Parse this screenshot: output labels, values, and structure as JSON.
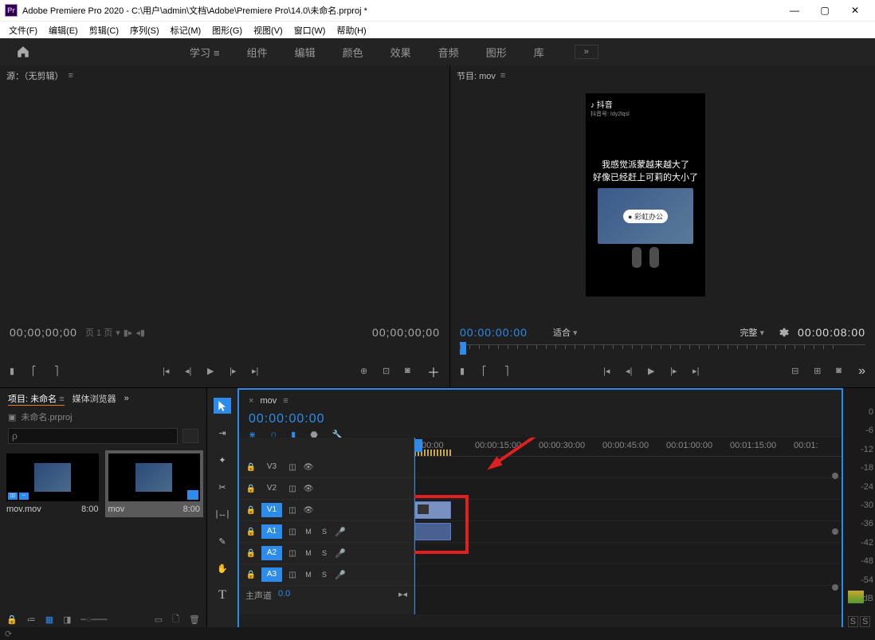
{
  "title": "Adobe Premiere Pro 2020 - C:\\用户\\admin\\文档\\Adobe\\Premiere Pro\\14.0\\未命名.prproj *",
  "menu": [
    "文件(F)",
    "编辑(E)",
    "剪辑(C)",
    "序列(S)",
    "标记(M)",
    "图形(G)",
    "视图(V)",
    "窗口(W)",
    "帮助(H)"
  ],
  "workspaces": {
    "items": [
      "学习",
      "组件",
      "编辑",
      "颜色",
      "效果",
      "音频",
      "图形",
      "库"
    ],
    "active": "学习",
    "more": "»"
  },
  "source": {
    "title": "源：（无剪辑）",
    "tc_left": "00;00;00;00",
    "tc_right": "00;00;00;00",
    "page": "页 1 页"
  },
  "program": {
    "title": "节目: mov",
    "tc_left": "00:00:00:00",
    "fit": "适合",
    "full": "完整",
    "tc_right": "00:00:08:00",
    "video": {
      "brand": "♪ 抖音",
      "brand_sub": "抖音号: Idy2lqsl",
      "caption1": "我感觉派蒙越来越大了",
      "caption2": "好像已经赶上可莉的大小了",
      "badge": "● 彩虹办公"
    }
  },
  "project": {
    "tabs": [
      "项目: 未命名",
      "媒体浏览器"
    ],
    "file": "未命名.prproj",
    "search_placeholder": "ρ",
    "items": [
      {
        "name": "mov.mov",
        "dur": "8:00"
      },
      {
        "name": "mov",
        "dur": "8:00"
      }
    ]
  },
  "timeline": {
    "seq": "mov",
    "tc": "00:00:00:00",
    "ruler": [
      ":00:00",
      "00:00:15:00",
      "00:00:30:00",
      "00:00:45:00",
      "00:01:00:00",
      "00:01:15:00",
      "00:01:"
    ],
    "tracks_v": [
      "V3",
      "V2",
      "V1"
    ],
    "tracks_a": [
      "A1",
      "A2",
      "A3"
    ],
    "master": "主声道",
    "master_val": "0.0",
    "mute": "M",
    "solo": "S"
  },
  "meters": {
    "scale": [
      "0",
      "-6",
      "-12",
      "-18",
      "-24",
      "-30",
      "-36",
      "-42",
      "-48",
      "-54"
    ],
    "db": "dB",
    "s": "S"
  }
}
